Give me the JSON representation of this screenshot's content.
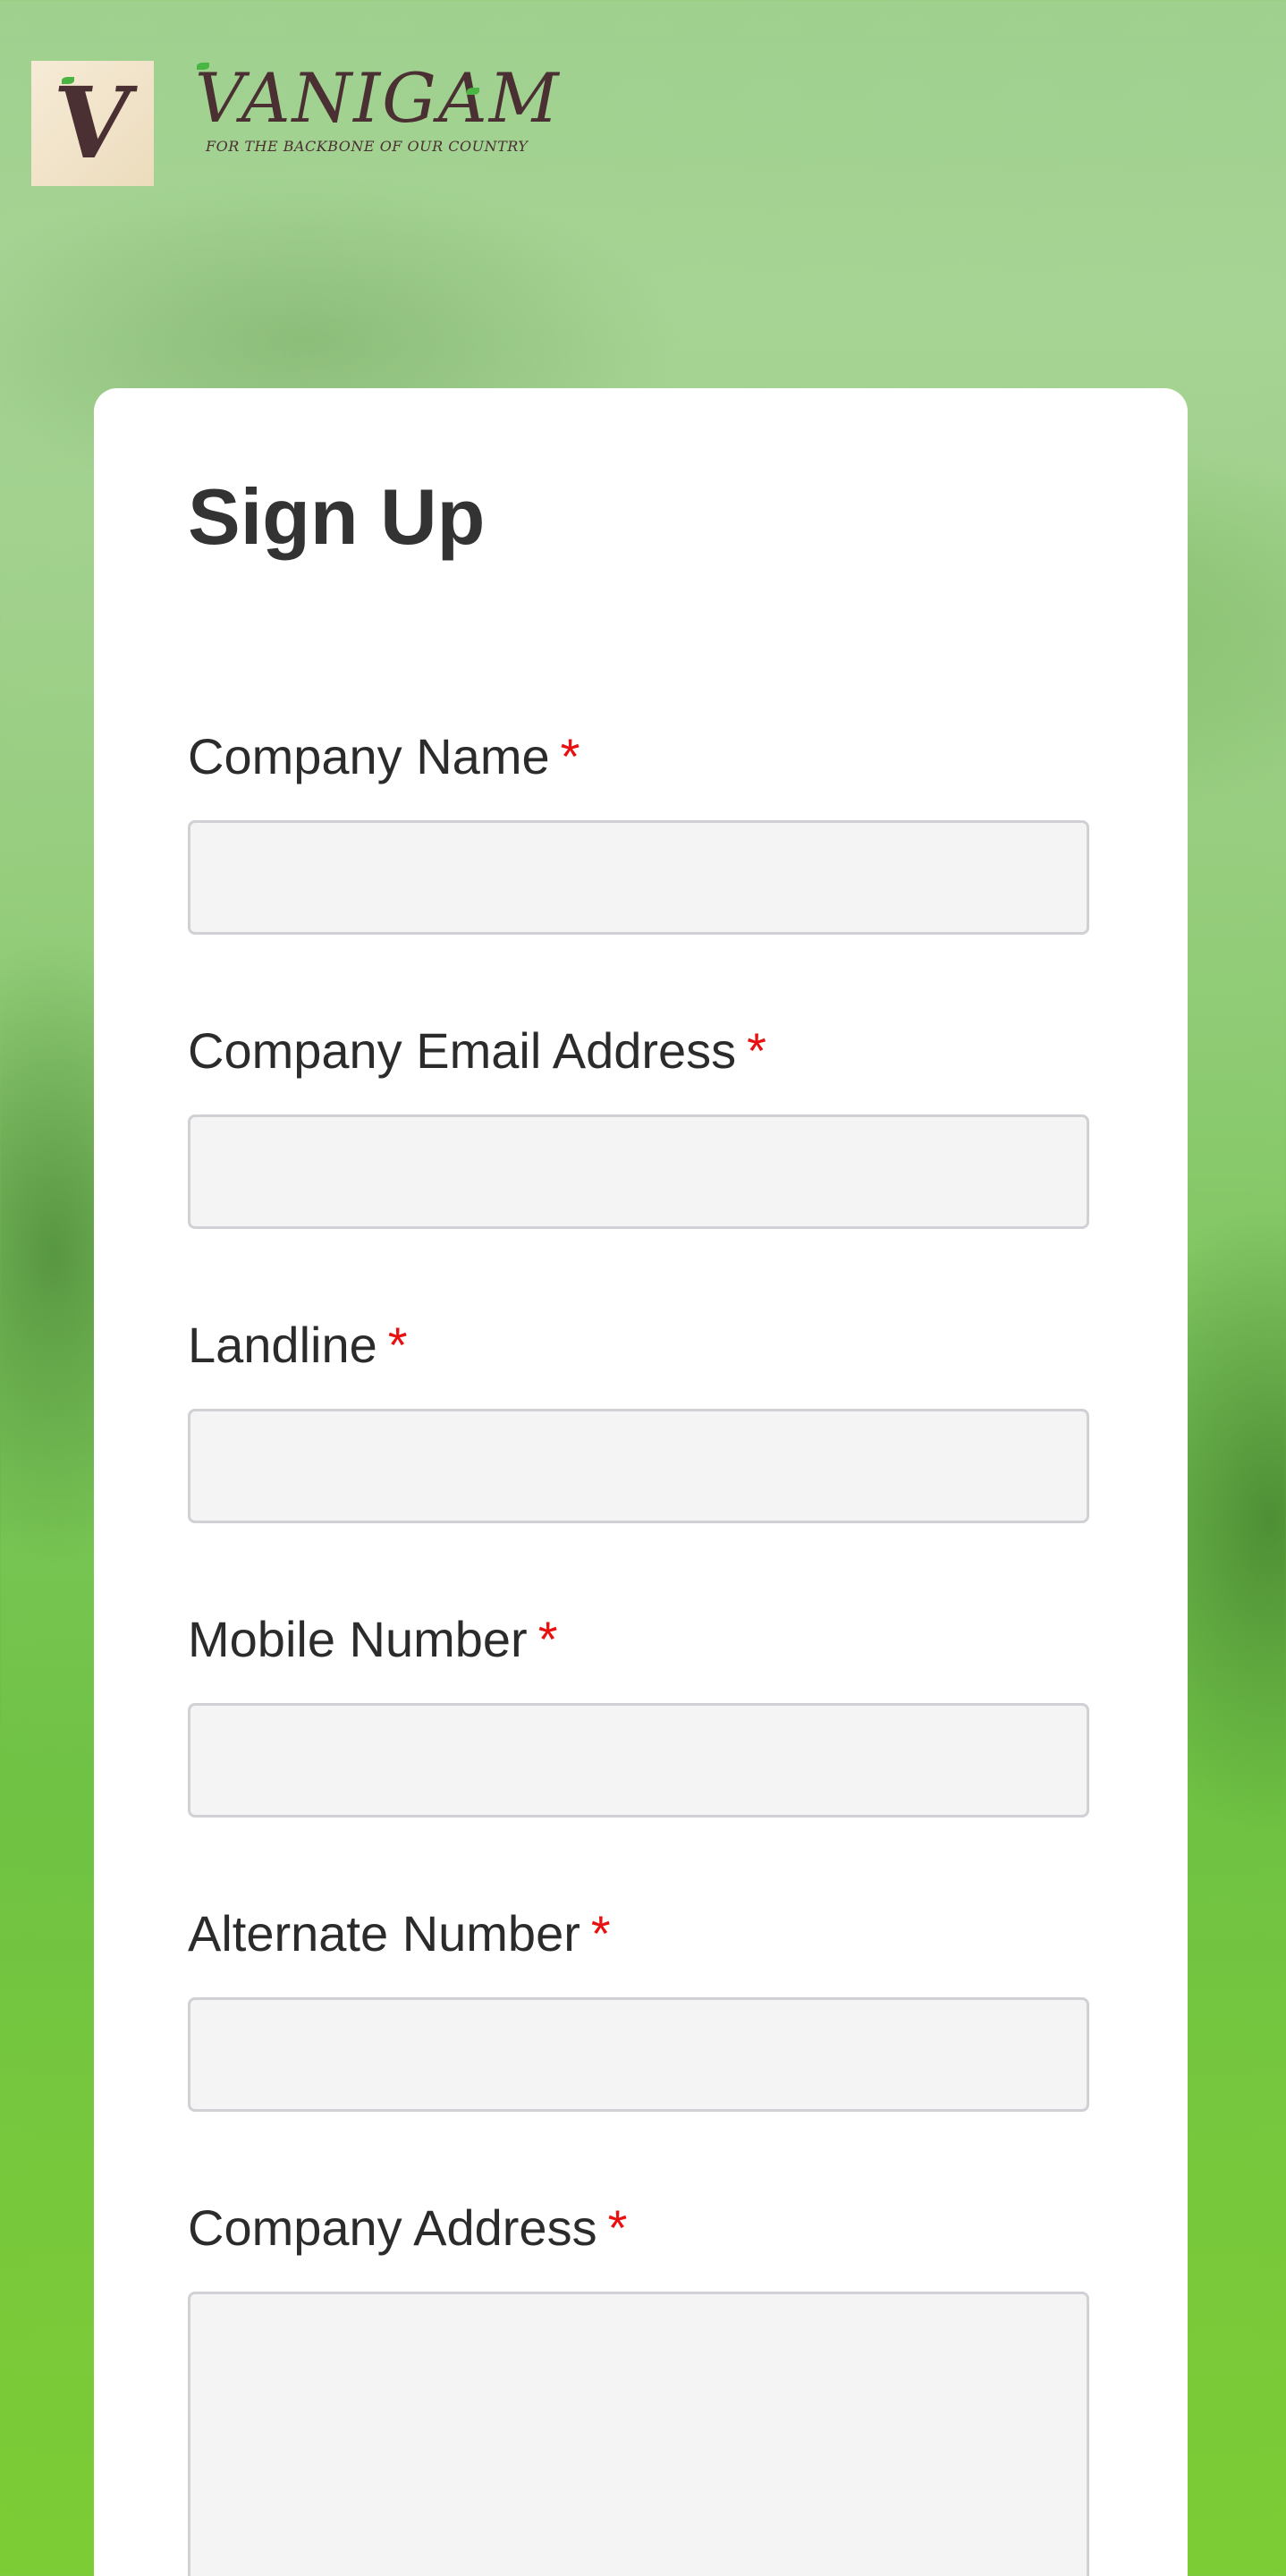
{
  "brand": {
    "logo_letter": "V",
    "name": "VANIGAM",
    "tagline": "FOR THE BACKBONE OF OUR COUNTRY"
  },
  "form": {
    "title": "Sign Up",
    "required_marker": "*",
    "fields": [
      {
        "label": "Company Name",
        "value": "",
        "placeholder": ""
      },
      {
        "label": "Company Email Address",
        "value": "",
        "placeholder": ""
      },
      {
        "label": "Landline",
        "value": "",
        "placeholder": ""
      },
      {
        "label": "Mobile Number",
        "value": "",
        "placeholder": ""
      },
      {
        "label": "Alternate Number",
        "value": "",
        "placeholder": ""
      },
      {
        "label": "Company Address",
        "value": "",
        "placeholder": ""
      }
    ]
  },
  "colors": {
    "required": "#e81010",
    "title": "#333333",
    "brand": "#4a2f33",
    "input_bg": "#f4f4f4"
  }
}
